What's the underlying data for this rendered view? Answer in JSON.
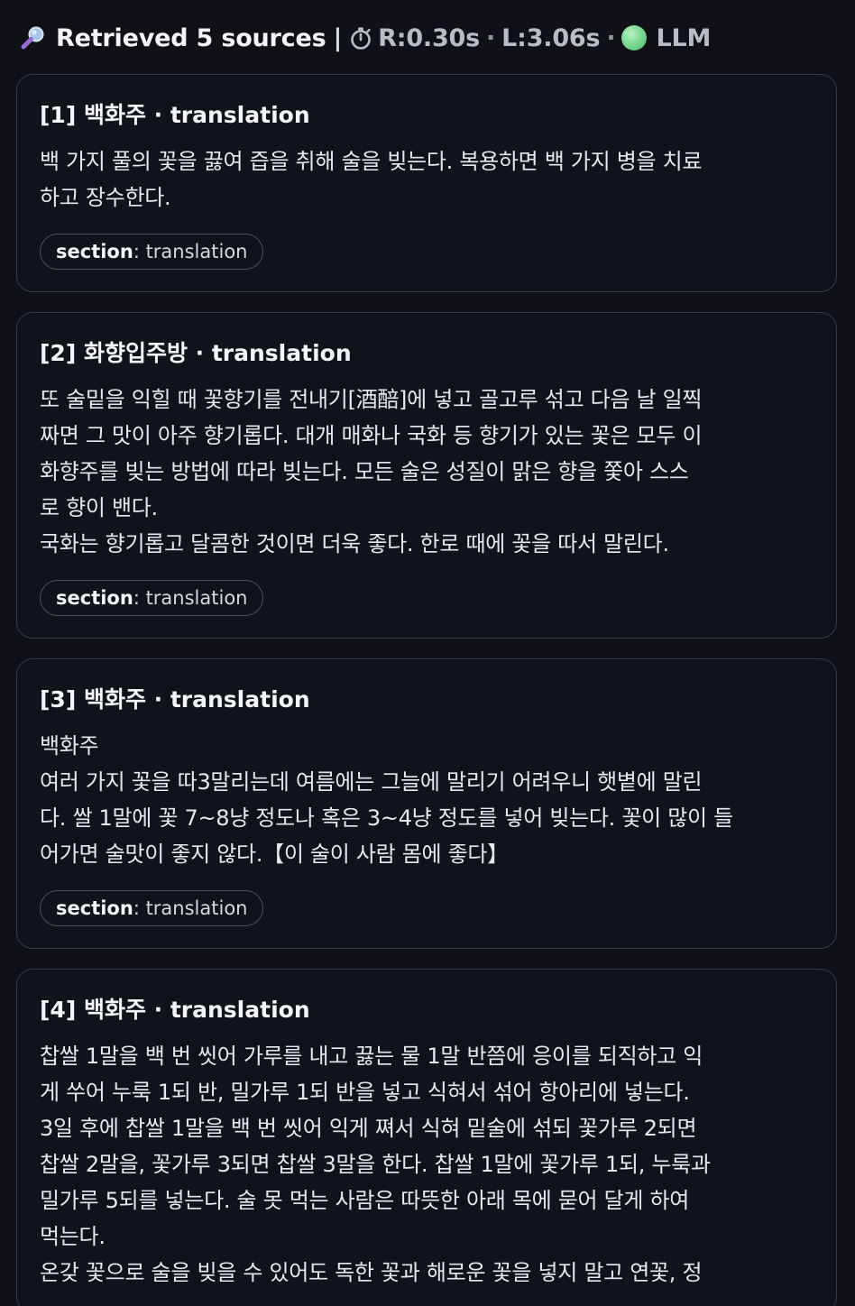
{
  "header": {
    "title": "Retrieved 5 sources",
    "separator": "|",
    "retrieval_time": "R:0.30s",
    "llm_time": "L:3.06s",
    "dot": "·",
    "mode": "LLM",
    "search_icon": "magnifying-glass-icon",
    "timer_icon": "stopwatch-icon",
    "status_color": "#7dd991"
  },
  "sources": [
    {
      "title": "[1] 백화주 · translation",
      "body": "백 가지 풀의 꽃을 끓여 즙을 취해 술을 빚는다. 복용하면 백 가지 병을 치료\n하고 장수한다.",
      "chip_key": "section",
      "chip_value": ": translation"
    },
    {
      "title": "[2] 화향입주방 · translation",
      "body": "또 술밑을 익힐 때 꽃향기를 전내기[酒醅]에 넣고 골고루 섞고 다음 날 일찍\n짜면 그 맛이 아주 향기롭다. 대개 매화나 국화 등 향기가 있는 꽃은 모두 이\n화향주를 빚는 방법에 따라 빚는다. 모든 술은 성질이 맑은 향을 쫓아 스스\n로 향이 밴다.\n국화는 향기롭고 달콤한 것이면 더욱 좋다. 한로 때에 꽃을 따서 말린다.",
      "chip_key": "section",
      "chip_value": ": translation"
    },
    {
      "title": "[3] 백화주 · translation",
      "body": "백화주\n여러 가지 꽃을 따3말리는데 여름에는 그늘에 말리기 어려우니 햇볕에 말린\n다. 쌀 1말에 꽃 7~8냥 정도나 혹은 3~4냥 정도를 넣어 빚는다. 꽃이 많이 들\n어가면 술맛이 좋지 않다.【이 술이 사람 몸에 좋다】",
      "chip_key": "section",
      "chip_value": ": translation"
    },
    {
      "title": "[4] 백화주 · translation",
      "body": "찹쌀 1말을 백 번 씻어 가루를 내고 끓는 물 1말 반쯤에 응이를 되직하고 익\n게 쑤어 누룩 1되 반, 밀가루 1되 반을 넣고 식혀서 섞어 항아리에 넣는다.\n3일 후에 찹쌀 1말을 백 번 씻어 익게 쪄서 식혀 밑술에 섞되 꽃가루 2되면\n찹쌀 2말을, 꽃가루 3되면 찹쌀 3말을 한다. 찹쌀 1말에 꽃가루 1되, 누룩과\n밀가루 5되를 넣는다. 술 못 먹는 사람은 따뜻한 아래 목에 묻어 달게 하여\n먹는다.\n온갖 꽃으로 술을 빚을 수 있어도 독한 꽃과 해로운 꽃을 넣지 말고 연꽃, 정",
      "chip_key": "section",
      "chip_value": ": translation"
    }
  ]
}
